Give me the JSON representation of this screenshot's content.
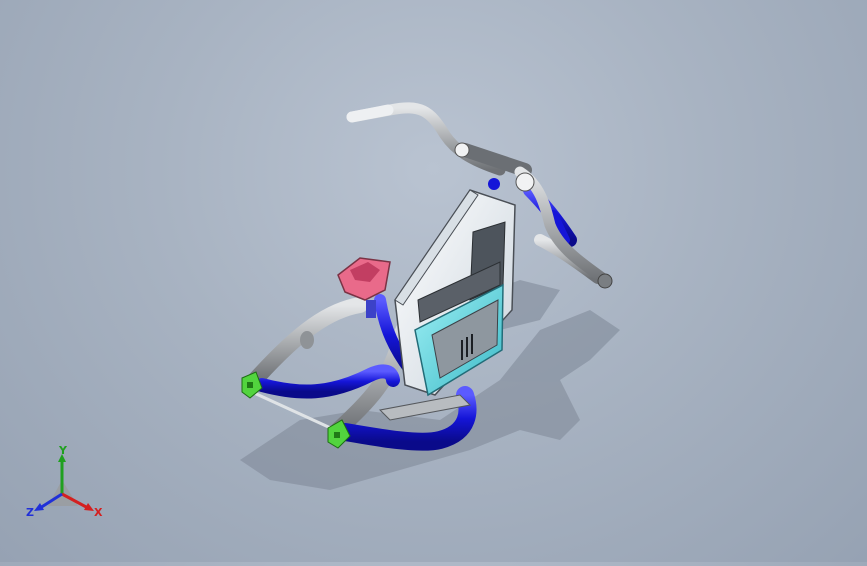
{
  "viewport": {
    "background_top": "#b9c3d1",
    "background_bottom": "#96a2b3",
    "model": "motorcycle-frame-assembly"
  },
  "colors": {
    "tube_blue": "#1515d8",
    "tube_gray": "#a9acaf",
    "tank_white": "#eef2f5",
    "panel_cyan": "#5fd6e0",
    "seat_pink": "#ec7f98",
    "bracket_green": "#4cc83c"
  },
  "triad": {
    "x_label": "X",
    "y_label": "Y",
    "z_label": "Z",
    "x_color": "#d42020",
    "y_color": "#20a020",
    "z_color": "#2030d8"
  }
}
